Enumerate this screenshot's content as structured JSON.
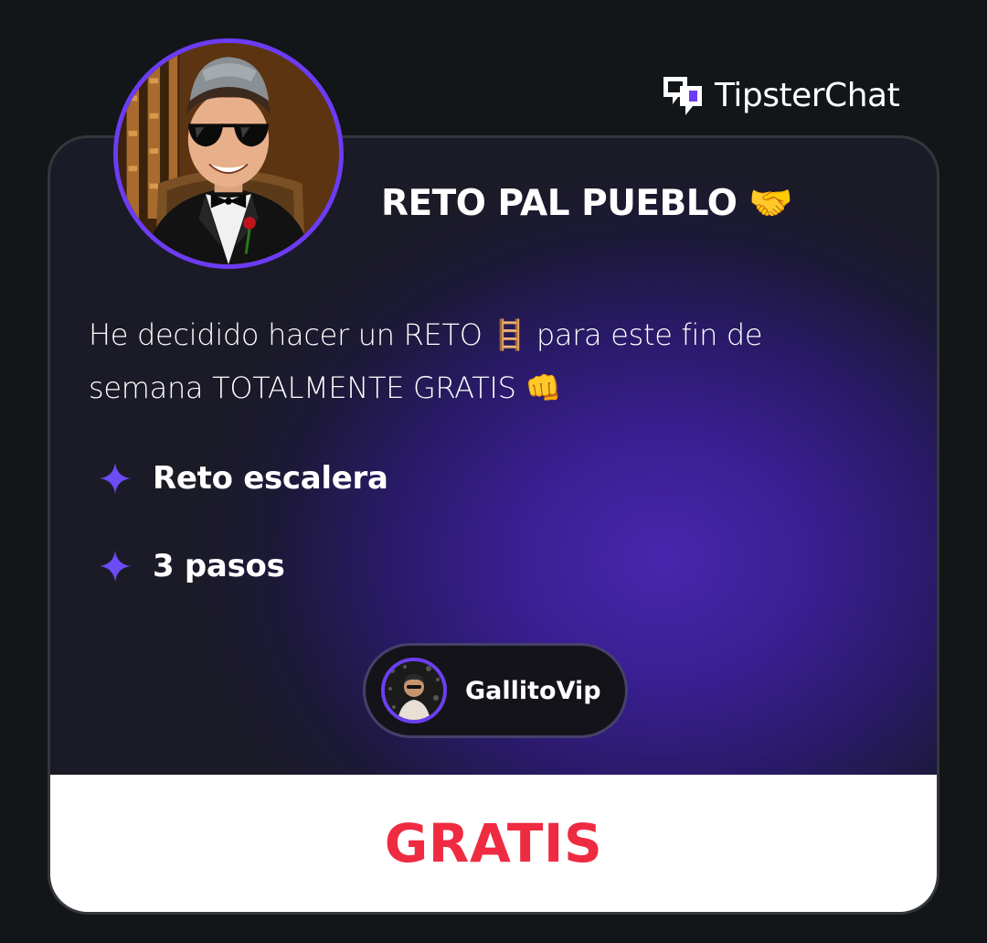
{
  "brand": {
    "name": "TipsterChat",
    "icon": "tipsterchat-logo-icon"
  },
  "post": {
    "title": "RETO PAL PUEBLO 🤝",
    "description_line1": "He decidido hacer un RETO 🪜 para este fin de",
    "description_line2": "semana TOTALMENTE GRATIS 👊",
    "features": [
      {
        "icon": "sparkle-icon",
        "label": "Reto escalera"
      },
      {
        "icon": "sparkle-icon",
        "label": "3 pasos"
      }
    ],
    "author": {
      "name": "GallitoVip",
      "avatar": "tipster-avatar"
    },
    "price": "GRATIS"
  },
  "colors": {
    "background": "#131619",
    "accent": "#6c3cf5",
    "price": "#ef2b41"
  }
}
